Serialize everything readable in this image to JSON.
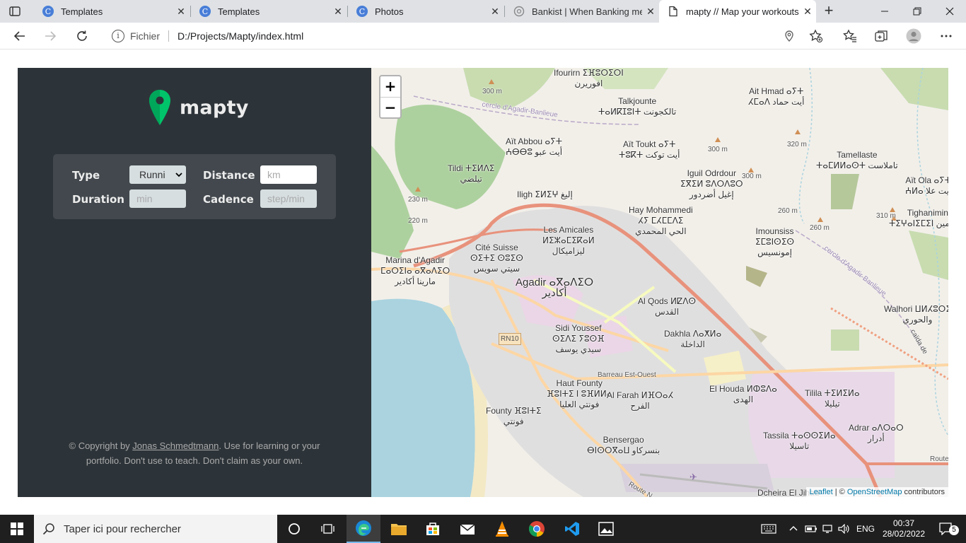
{
  "browser": {
    "tabs": [
      {
        "title": "Templates",
        "favicon": "canva-icon"
      },
      {
        "title": "Templates",
        "favicon": "canva-icon"
      },
      {
        "title": "Photos",
        "favicon": "canva-icon"
      },
      {
        "title": "Bankist | When Banking meet",
        "favicon": "bankist-icon"
      },
      {
        "title": "mapty // Map your workouts",
        "favicon": "document-icon",
        "active": true
      }
    ],
    "address": {
      "scheme_label": "Fichier",
      "url": "D:/Projects/Mapty/index.html"
    }
  },
  "app": {
    "brand": "mapty",
    "brand_color": "#00c46a",
    "form": {
      "type_label": "Type",
      "type_value": "Runni",
      "distance_label": "Distance",
      "distance_placeholder": "km",
      "duration_label": "Duration",
      "duration_placeholder": "min",
      "cadence_label": "Cadence",
      "cadence_placeholder": "step/min"
    },
    "copyright": {
      "prefix": "© Copyright by ",
      "author": "Jonas Schmedtmann",
      "suffix_line1": ". Use for learning or your",
      "line2": "portfolio. Don't use to teach. Don't claim as your own."
    }
  },
  "map": {
    "zoom_in": "+",
    "zoom_out": "−",
    "attribution": {
      "leaflet": "Leaflet",
      "sep": " | © ",
      "osm": "OpenStreetMap",
      "suffix": " contributors"
    },
    "labels": [
      {
        "id": "ifourirn",
        "lines": [
          "Ifourirn ⵉⴼⵓⵔⵉⵔⵏ",
          "افوريرن"
        ]
      },
      {
        "id": "talkjounte",
        "lines": [
          "Talkjounte",
          "ⵜⴰⵍⴽⵊⵓⵏⵜ تالكجونت"
        ]
      },
      {
        "id": "ait-hmad",
        "lines": [
          "Ait Hmad ⴰⵢⵜ",
          "ⵃⵎⴰⴷ أيت حماد"
        ]
      },
      {
        "id": "ait-abbou",
        "lines": [
          "Aït Abbou ⴰⵢⵜ",
          "ⵄⴱⴱⵓ أيت عبو"
        ]
      },
      {
        "id": "ait-toukt",
        "lines": [
          "Aït Toukt ⴰⵢⵜ",
          "ⵜⵓⴽⵜ أيت توكت"
        ]
      },
      {
        "id": "tamellaste",
        "lines": [
          "Tamellaste",
          "ⵜⴰⵎⵍⵍⴰⵙⵜ تاملاست"
        ]
      },
      {
        "id": "tildi",
        "lines": [
          "Tildi ⵜⵉⵍⴷⵉ",
          "تيلضي"
        ]
      },
      {
        "id": "iguil-odrdour",
        "lines": [
          "Iguil Odrdour",
          "ⵉⴳⵉⵍ ⵓⴷⵔⴷⵓⵔ",
          "إغيل أضردور"
        ]
      },
      {
        "id": "ait-ola",
        "lines": [
          "Aït Ola ⴰⵢⵜ",
          "ⵄⵍⴰ أيت علا"
        ]
      },
      {
        "id": "iligh",
        "lines": [
          "Iligh ⵉⵍⵉⵖ إليغ"
        ]
      },
      {
        "id": "hay-mohammedi",
        "lines": [
          "Hay Mohammedi",
          "ⵃⵢ ⵎⵃⵎⵎⴷⵉ",
          "الحي المحمدي"
        ]
      },
      {
        "id": "tighanimin",
        "lines": [
          "Tighanimin",
          "ⵜⵉⵖⴰⵏⵉⵎⵉⵏ تيغانيمين"
        ]
      },
      {
        "id": "les-amicales",
        "lines": [
          "Les Amicales",
          "ⵍⵉⵣⴰⵎⵉⴽⴰⵍ",
          "ليزاميكال"
        ]
      },
      {
        "id": "imounsiss",
        "lines": [
          "Imounsiss",
          "ⵉⵎⵓⵏⵙⵉⵙ",
          "إمونسيس"
        ]
      },
      {
        "id": "cite-suisse",
        "lines": [
          "Cité Suisse",
          "ⵙⵉⵜⵉ ⵙⵓⵉⵙ",
          "سيتي سويس"
        ]
      },
      {
        "id": "marina",
        "lines": [
          "Marina d'Agadir",
          "ⵎⴰⵔⵉⵏⴰ ⴰⴳⴰⴷⵉⵔ",
          "مارينا أكادير"
        ]
      },
      {
        "id": "agadir",
        "lines": [
          "Agadir ⴰⴳⴰⴷⵉⵔ",
          "أكادير"
        ]
      },
      {
        "id": "al-qods",
        "lines": [
          "Al Qods ⵍⵇⴷⵙ",
          "القدس"
        ]
      },
      {
        "id": "walhori",
        "lines": [
          "Walhori ⵡⵍⵃⵓⵔⵉ",
          "والحوري"
        ]
      },
      {
        "id": "sidi-youssef",
        "lines": [
          "Sidi Youssef",
          "ⵙⵉⴷⵉ ⵢⵓⵙⴼ",
          "سيدي يوسف"
        ]
      },
      {
        "id": "dakhla",
        "lines": [
          "Dakhla ⴷⴰⵅⵍⴰ",
          "الداخلة"
        ]
      },
      {
        "id": "haut-founty",
        "lines": [
          "Haut Founty",
          "ⴼⵓⵏⵜⵉ ⵏ ⵓⴼⵍⵍⴰ",
          "فونتي العليا"
        ]
      },
      {
        "id": "al-farah",
        "lines": [
          "Al Farah ⵍⴼⵔⴰⵃ",
          "الفرح"
        ]
      },
      {
        "id": "el-houda",
        "lines": [
          "El Houda ⵍⵀⵓⴷⴰ",
          "الهدى"
        ]
      },
      {
        "id": "tilila",
        "lines": [
          "Tilila ⵜⵉⵍⵉⵍⴰ",
          "تيليلا"
        ]
      },
      {
        "id": "founty",
        "lines": [
          "Founty ⴼⵓⵏⵜⵉ",
          "فونتي"
        ]
      },
      {
        "id": "bensergao",
        "lines": [
          "Bensergao",
          "ⴱⵏⵙⵔⴳⴰⵡ بنسركاو"
        ]
      },
      {
        "id": "tassila",
        "lines": [
          "Tassila ⵜⴰⵙⵙⵉⵍⴰ",
          "تاسيلا"
        ]
      },
      {
        "id": "adrar",
        "lines": [
          "Adrar ⴰⴷⵔⴰⵔ",
          "أدرار"
        ]
      },
      {
        "id": "dcheira",
        "lines": [
          "Dcheira El Jihad"
        ]
      }
    ],
    "small_labels": [
      {
        "id": "e300a",
        "text": "300 m"
      },
      {
        "id": "e300b",
        "text": "300 m"
      },
      {
        "id": "e320",
        "text": "320 m"
      },
      {
        "id": "e300c",
        "text": "300 m"
      },
      {
        "id": "e230",
        "text": "230 m"
      },
      {
        "id": "e220",
        "text": "220 m"
      },
      {
        "id": "e260a",
        "text": "260 m"
      },
      {
        "id": "e260b",
        "text": "260 m"
      },
      {
        "id": "e310",
        "text": "310 m"
      },
      {
        "id": "cercle1",
        "text": "cercle d'Agadir-Banlieue"
      },
      {
        "id": "cercle2",
        "text": "cercle d'Agadir-Banlieue"
      },
      {
        "id": "rn10",
        "text": "RN10"
      },
      {
        "id": "barreau",
        "text": "Barreau Est-Ouest"
      },
      {
        "id": "caida",
        "text": "caïda de"
      },
      {
        "id": "route",
        "text": "Route"
      },
      {
        "id": "route-n",
        "text": "Route N"
      }
    ]
  },
  "taskbar": {
    "search_placeholder": "Taper ici pour rechercher",
    "language": "ENG",
    "time": "00:37",
    "date": "28/02/2022",
    "notifications": "5"
  }
}
